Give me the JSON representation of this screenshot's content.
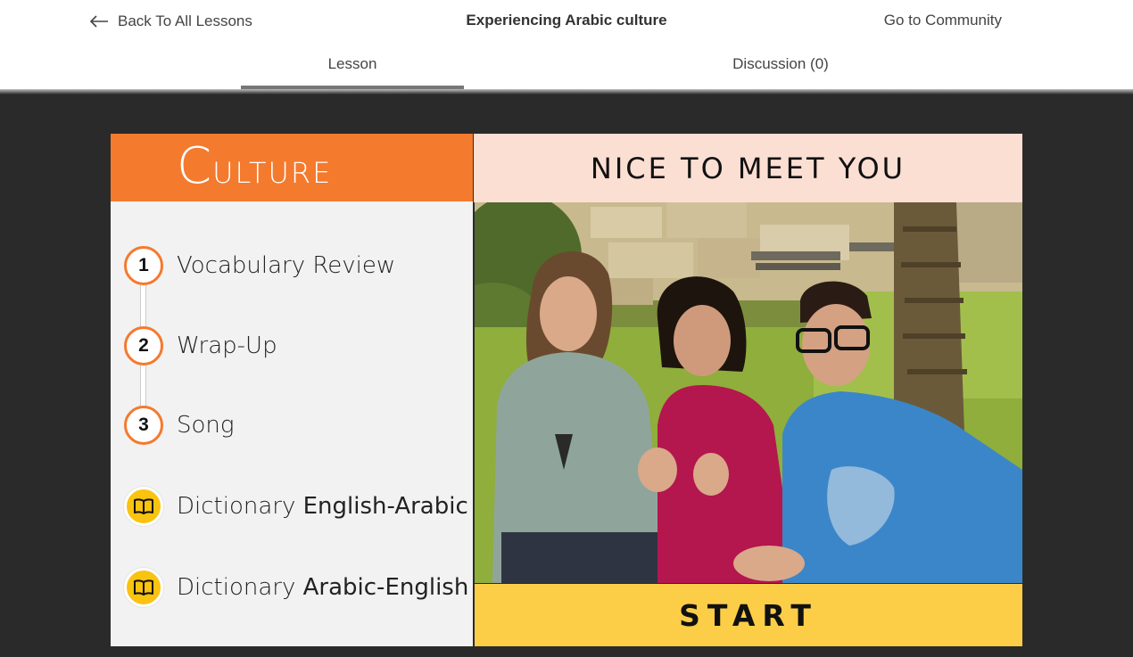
{
  "header": {
    "back_label": "Back To All Lessons",
    "title": "Experiencing Arabic culture",
    "community_label": "Go to Community"
  },
  "tabs": [
    {
      "label": "Lesson",
      "active": true
    },
    {
      "label": "Discussion (0)",
      "active": false
    }
  ],
  "culture": {
    "title_first": "C",
    "title_rest": "ULTURE",
    "steps": [
      {
        "number": "1",
        "label": "Vocabulary Review"
      },
      {
        "number": "2",
        "label": "Wrap-Up"
      },
      {
        "number": "3",
        "label": "Song"
      }
    ],
    "dictionaries": [
      {
        "prefix": "Dictionary",
        "pair": "English-Arabic",
        "icon": "book-icon"
      },
      {
        "prefix": "Dictionary",
        "pair": "Arabic-English",
        "icon": "book-icon"
      }
    ]
  },
  "lesson": {
    "title": "NICE TO MEET YOU",
    "start_label": "START"
  },
  "colors": {
    "accent_orange": "#f47a2e",
    "title_bg": "#fcdfd3",
    "start_bg": "#fcce47",
    "dict_icon_bg": "#f9c30f",
    "stage_bg": "#2a2a2a"
  }
}
